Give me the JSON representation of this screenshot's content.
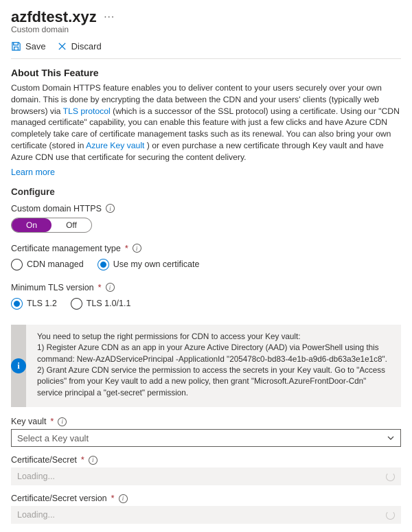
{
  "colors": {
    "accent": "#0078d4",
    "toggle_on": "#881798",
    "danger": "#a4262c"
  },
  "header": {
    "title": "azfdtest.xyz",
    "subtitle": "Custom domain",
    "more_icon": "ellipsis-icon"
  },
  "toolbar": {
    "save_label": "Save",
    "discard_label": "Discard"
  },
  "about": {
    "heading": "About This Feature",
    "text_part1": "Custom Domain HTTPS feature enables you to deliver content to your users securely over your own domain. This is done by encrypting the data between the CDN and your users' clients (typically web browsers) via ",
    "tls_link": "TLS protocol",
    "text_part2": " (which is a successor of the SSL protocol) using a certificate. Using our \"CDN managed certificate\" capability, you can enable this feature with just a few clicks and have Azure CDN completely take care of certificate management tasks such as its renewal. You can also bring your own certificate (stored in ",
    "akv_link": "Azure Key vault",
    "text_part3": " ) or even purchase a new certificate through Key vault and have Azure CDN use that certificate for securing the content delivery.",
    "learn_more": "Learn more"
  },
  "configure": {
    "heading": "Configure",
    "https_label": "Custom domain HTTPS",
    "toggle": {
      "on": "On",
      "off": "Off",
      "value": "On"
    },
    "cert_mgmt": {
      "label": "Certificate management type",
      "options": {
        "cdn": "CDN managed",
        "own": "Use my own certificate"
      },
      "selected": "own"
    },
    "tls": {
      "label": "Minimum TLS version",
      "options": {
        "v12": "TLS 1.2",
        "v10": "TLS 1.0/1.1"
      },
      "selected": "v12"
    }
  },
  "alert": {
    "line0": "You need to setup the right permissions for CDN to access your Key vault:",
    "line1": "1) Register Azure CDN as an app in your Azure Active Directory (AAD) via PowerShell using this command: New-AzADServicePrincipal -ApplicationId \"205478c0-bd83-4e1b-a9d6-db63a3e1e1c8\".",
    "line2": "2) Grant Azure CDN service the permission to access the secrets in your Key vault. Go to \"Access policies\" from your Key vault to add a new policy, then grant \"Microsoft.AzureFrontDoor-Cdn\" service principal a \"get-secret\" permission."
  },
  "keyvault": {
    "label": "Key vault",
    "placeholder": "Select a Key vault"
  },
  "certsecret": {
    "label": "Certificate/Secret",
    "placeholder": "Loading..."
  },
  "certversion": {
    "label": "Certificate/Secret version",
    "placeholder": "Loading..."
  }
}
